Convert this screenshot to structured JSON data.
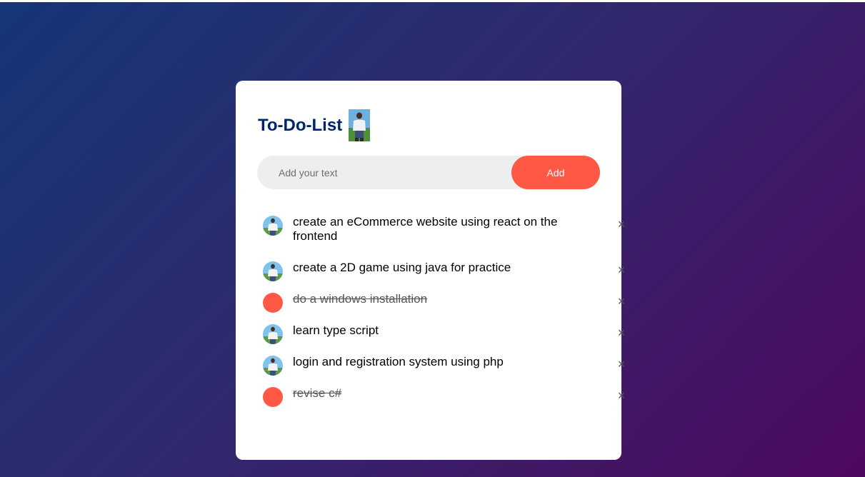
{
  "app": {
    "title": "To-Do-List"
  },
  "input": {
    "placeholder": "Add your text",
    "value": "",
    "add_label": "Add"
  },
  "tasks": [
    {
      "text": "create an eCommerce website using react on the frontend",
      "checked": false
    },
    {
      "text": "create a 2D game using java for practice",
      "checked": false
    },
    {
      "text": "do a windows installation",
      "checked": true
    },
    {
      "text": "learn type script",
      "checked": false
    },
    {
      "text": "login and registration system using php",
      "checked": false
    },
    {
      "text": "revise c#",
      "checked": true
    }
  ],
  "icons": {
    "remove": "close-icon",
    "unchecked": "avatar-icon",
    "checked": "checked-circle-icon"
  },
  "colors": {
    "accent": "#ff5945",
    "title": "#002765",
    "input_bg": "#edeef0",
    "gradient_start": "#153677",
    "gradient_end": "#4e085f"
  }
}
